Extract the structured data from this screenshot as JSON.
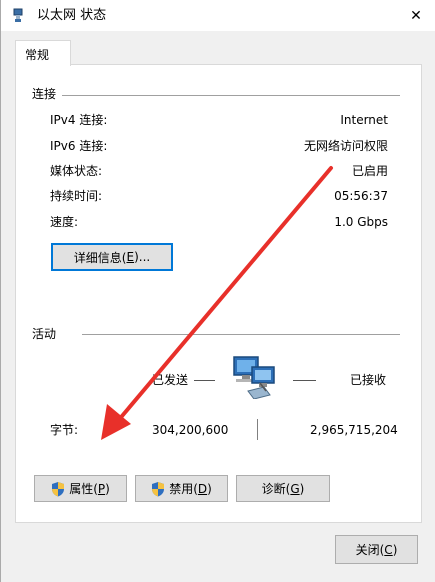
{
  "window": {
    "title": "以太网 状态",
    "close_glyph": "✕"
  },
  "tabs": [
    {
      "label": "常规"
    }
  ],
  "connection": {
    "section_label": "连接",
    "rows": [
      {
        "label": "IPv4 连接:",
        "value": "Internet"
      },
      {
        "label": "IPv6 连接:",
        "value": "无网络访问权限"
      },
      {
        "label": "媒体状态:",
        "value": "已启用"
      },
      {
        "label": "持续时间:",
        "value": "05:56:37"
      },
      {
        "label": "速度:",
        "value": "1.0 Gbps"
      }
    ],
    "details_button": {
      "text": "详细信息(",
      "key": "E",
      "tail": ")..."
    }
  },
  "activity": {
    "section_label": "活动",
    "sent_label": "已发送",
    "received_label": "已接收",
    "bytes_label": "字节:",
    "bytes_sent": "304,200,600",
    "bytes_received": "2,965,715,204"
  },
  "buttons": {
    "properties": {
      "text": "属性(",
      "key": "P",
      "tail": ")"
    },
    "disable": {
      "text": "禁用(",
      "key": "D",
      "tail": ")"
    },
    "diagnose": {
      "text": "诊断(",
      "key": "G",
      "tail": ")"
    },
    "close": {
      "text": "关闭(",
      "key": "C",
      "tail": ")"
    }
  },
  "colors": {
    "accent_focus": "#0078d7",
    "annotation_arrow": "#e8302a"
  }
}
